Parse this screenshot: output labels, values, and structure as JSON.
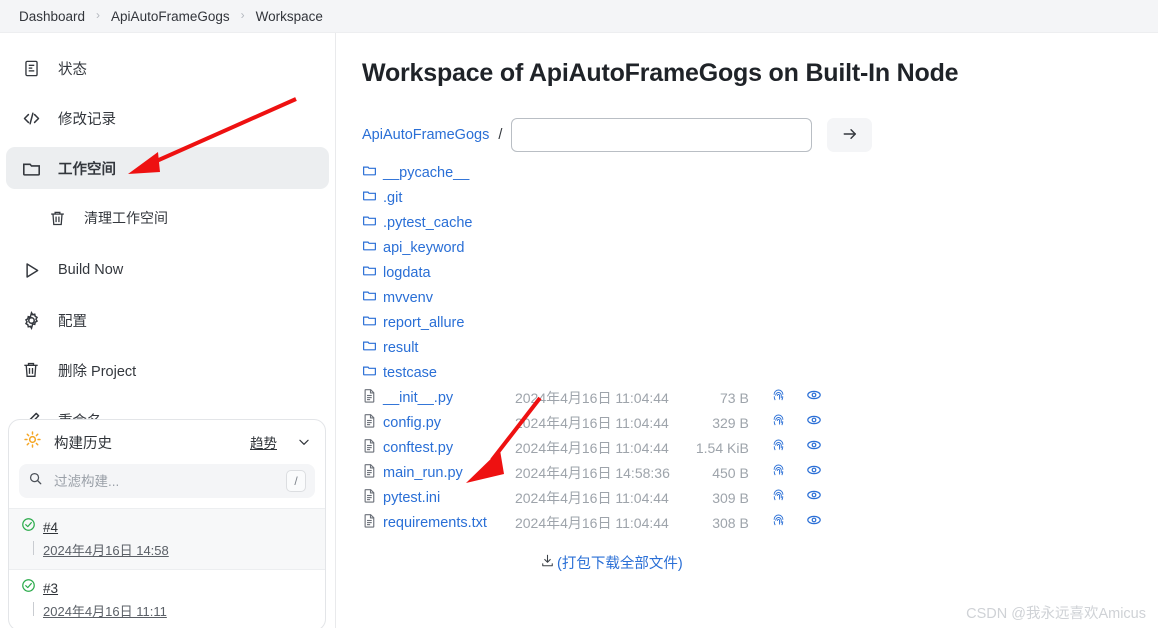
{
  "breadcrumb": {
    "items": [
      "Dashboard",
      "ApiAutoFrameGogs",
      "Workspace"
    ],
    "separator": "›"
  },
  "sidebar": {
    "items": [
      {
        "label": "状态",
        "icon": "document-icon",
        "active": false,
        "sub": false
      },
      {
        "label": "修改记录",
        "icon": "code-icon",
        "active": false,
        "sub": false
      },
      {
        "label": "工作空间",
        "icon": "folder-icon",
        "active": true,
        "sub": false
      },
      {
        "label": "清理工作空间",
        "icon": "trash-icon",
        "active": false,
        "sub": true
      },
      {
        "label": "Build Now",
        "icon": "play-icon",
        "active": false,
        "sub": false
      },
      {
        "label": "配置",
        "icon": "gear-icon",
        "active": false,
        "sub": false
      },
      {
        "label": "删除 Project",
        "icon": "trash-icon",
        "active": false,
        "sub": false
      },
      {
        "label": "重命名",
        "icon": "pencil-icon",
        "active": false,
        "sub": false
      }
    ]
  },
  "build_history": {
    "title": "构建历史",
    "trend_label": "趋势",
    "filter_placeholder": "过滤构建...",
    "filter_value": "",
    "shortcut_key": "/",
    "builds": [
      {
        "number": "#4",
        "date": "2024年4月16日 14:58",
        "status": "success"
      },
      {
        "number": "#3",
        "date": "2024年4月16日 11:11",
        "status": "success"
      }
    ]
  },
  "main": {
    "title": "Workspace of ApiAutoFrameGogs on Built-In Node",
    "path_root": "ApiAutoFrameGogs",
    "path_separator": "/",
    "path_input_value": "",
    "go_button_label": "→",
    "download_all_label": "(打包下载全部文件)",
    "entries": [
      {
        "name": "__pycache__",
        "type": "folder",
        "date": "",
        "size": ""
      },
      {
        "name": ".git",
        "type": "folder",
        "date": "",
        "size": ""
      },
      {
        "name": ".pytest_cache",
        "type": "folder",
        "date": "",
        "size": ""
      },
      {
        "name": "api_keyword",
        "type": "folder",
        "date": "",
        "size": ""
      },
      {
        "name": "logdata",
        "type": "folder",
        "date": "",
        "size": ""
      },
      {
        "name": "mvvenv",
        "type": "folder",
        "date": "",
        "size": ""
      },
      {
        "name": "report_allure",
        "type": "folder",
        "date": "",
        "size": ""
      },
      {
        "name": "result",
        "type": "folder",
        "date": "",
        "size": ""
      },
      {
        "name": "testcase",
        "type": "folder",
        "date": "",
        "size": ""
      },
      {
        "name": "__init__.py",
        "type": "file",
        "date": "2024年4月16日 11:04:44",
        "size": "73 B"
      },
      {
        "name": "config.py",
        "type": "file",
        "date": "2024年4月16日 11:04:44",
        "size": "329 B"
      },
      {
        "name": "conftest.py",
        "type": "file",
        "date": "2024年4月16日 11:04:44",
        "size": "1.54 KiB"
      },
      {
        "name": "main_run.py",
        "type": "file",
        "date": "2024年4月16日 14:58:36",
        "size": "450 B"
      },
      {
        "name": "pytest.ini",
        "type": "file",
        "date": "2024年4月16日 11:04:44",
        "size": "309 B"
      },
      {
        "name": "requirements.txt",
        "type": "file",
        "date": "2024年4月16日 11:04:44",
        "size": "308 B"
      }
    ]
  },
  "watermark": "CSDN @我永远喜欢Amicus",
  "colors": {
    "link": "#2a6fd6",
    "muted": "#9ea4ab",
    "accent_active_bg": "#eceef0",
    "success": "#2bab4b",
    "annotation": "#ee1111"
  }
}
